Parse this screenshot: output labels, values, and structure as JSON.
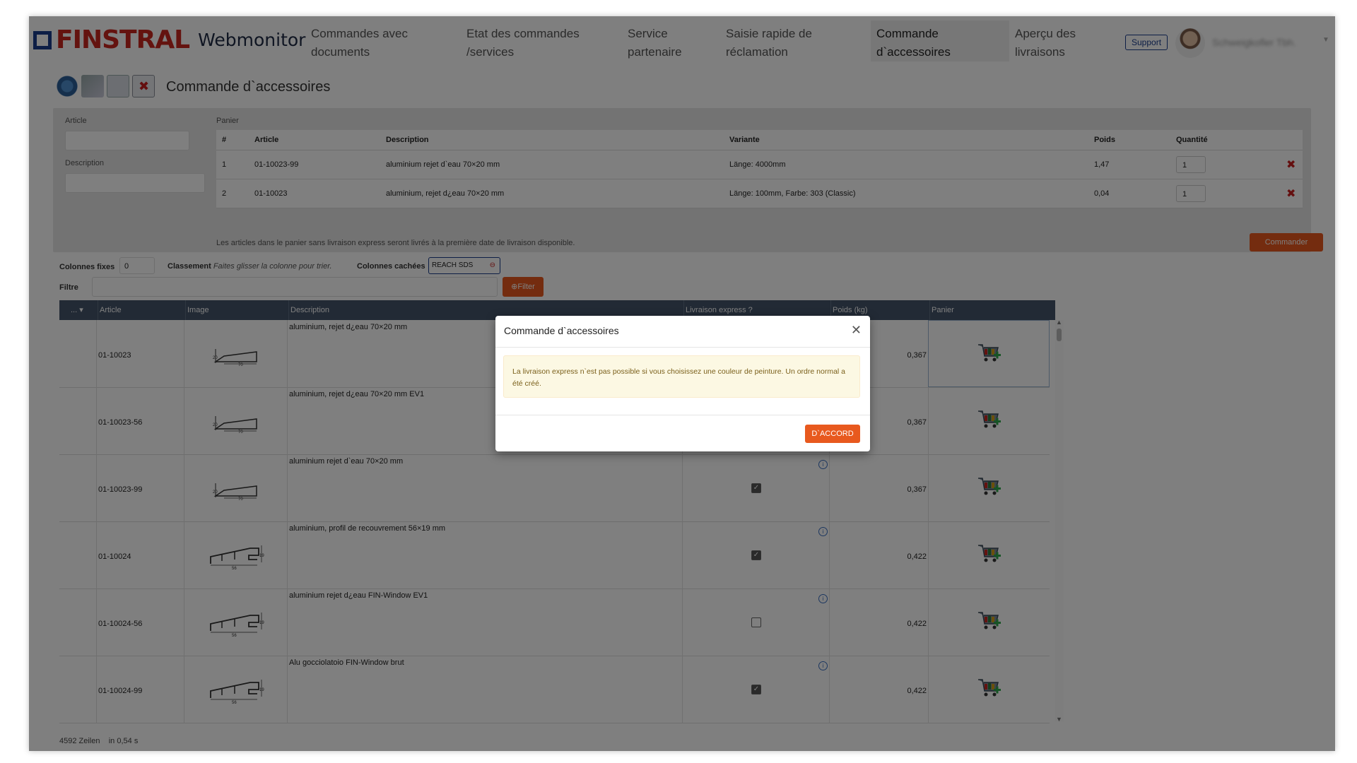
{
  "brand": {
    "logo_text": "FINSTRAL",
    "app_name": "Webmonitor"
  },
  "nav": {
    "items": [
      {
        "line1": "Commandes avec",
        "line2": "documents"
      },
      {
        "line1": "Etat des commandes",
        "line2": "/services"
      },
      {
        "line1": "Service",
        "line2": "partenaire"
      },
      {
        "line1": "Saisie rapide de",
        "line2": "réclamation"
      },
      {
        "line1": "Commande",
        "line2": "d`accessoires"
      },
      {
        "line1": "Aperçu des",
        "line2": "livraisons"
      }
    ],
    "support_label": "Support",
    "user_name": "Schweigkofler Tbh."
  },
  "page": {
    "title": "Commande d`accessoires"
  },
  "search": {
    "article_label": "Article",
    "description_label": "Description"
  },
  "cart": {
    "label": "Panier",
    "columns": [
      "#",
      "Article",
      "Description",
      "Variante",
      "Poids",
      "Quantité"
    ],
    "rows": [
      {
        "num": "1",
        "article": "01-10023-99",
        "description": "aluminium rejet d`eau 70×20 mm",
        "variant": "Länge: 4000mm",
        "weight": "1,47",
        "qty": "1"
      },
      {
        "num": "2",
        "article": "01-10023",
        "description": "aluminium, rejet d¿eau 70×20 mm",
        "variant": "Länge: 100mm, Farbe: 303 (Classic)",
        "weight": "0,04",
        "qty": "1"
      }
    ],
    "note": "Les articles dans le panier sans livraison express seront livrés à la première date de livraison disponible.",
    "order_button": "Commander"
  },
  "grid_controls": {
    "fixed_cols_label": "Colonnes fixes",
    "fixed_cols_value": "0",
    "sort_label": "Classement",
    "sort_hint": "Faites glisser la colonne pour trier.",
    "hidden_cols_label": "Colonnes cachées",
    "hidden_cols_value": "REACH SDS",
    "filter_label": "Filtre",
    "filter_button": "⊕Filter"
  },
  "grid": {
    "columns": [
      "... ▾",
      "Article",
      "Image",
      "Description",
      "Livraison express ?",
      "Poids (kg)",
      "Panier"
    ],
    "rows": [
      {
        "article": "01-10023",
        "description": "aluminium, rejet d¿eau 70×20 mm",
        "express": "hidden",
        "weight": "0,367"
      },
      {
        "article": "01-10023-56",
        "description": "aluminium, rejet d¿eau 70×20 mm EV1",
        "express": "hidden",
        "weight": "0,367"
      },
      {
        "article": "01-10023-99",
        "description": "aluminium rejet d`eau 70×20 mm",
        "express": true,
        "weight": "0,367"
      },
      {
        "article": "01-10024",
        "description": "aluminium, profil de recouvrement 56×19 mm",
        "express": true,
        "weight": "0,422"
      },
      {
        "article": "01-10024-56",
        "description": "aluminium rejet d¿eau FIN-Window EV1",
        "express": false,
        "weight": "0,422"
      },
      {
        "article": "01-10024-99",
        "description": "Alu gocciolatoio FIN-Window brut",
        "express": true,
        "weight": "0,422"
      }
    ],
    "footer_count": "4592 Zeilen",
    "footer_time": "in 0,54 s"
  },
  "modal": {
    "title": "Commande d`accessoires",
    "message": "La livraison express n`est pas possible si vous choisissez une couleur de peinture. Un ordre normal a été créé.",
    "ok_button": "D`ACCORD"
  }
}
